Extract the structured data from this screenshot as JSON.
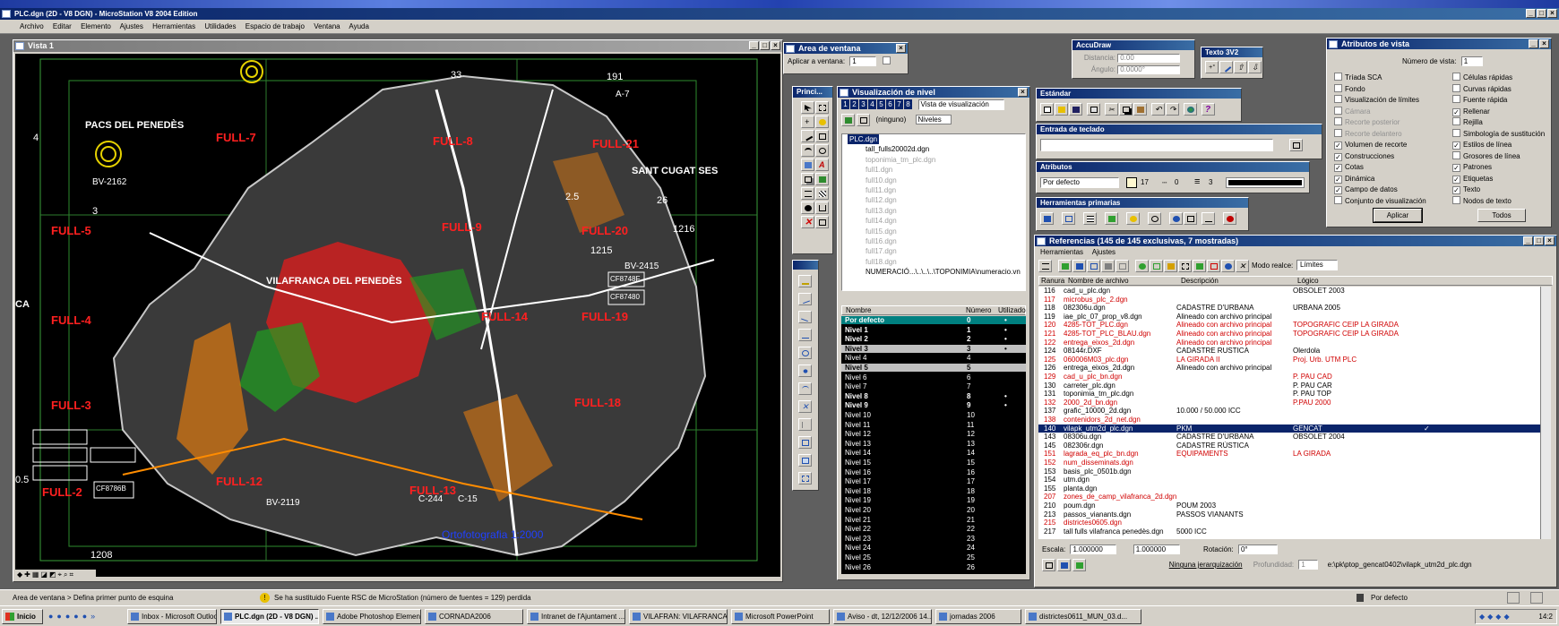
{
  "app": {
    "title": "PLC.dgn (2D - V8 DGN) - MicroStation V8 2004 Edition",
    "menu": [
      "Archivo",
      "Editar",
      "Elemento",
      "Ajustes",
      "Herramientas",
      "Utilidades",
      "Espacio de trabajo",
      "Ventana",
      "Ayuda"
    ]
  },
  "view": {
    "title": "Vista 1",
    "labels": {
      "pacs": "PACS DEL PENEDÈS",
      "santcugat": "SANT CUGAT SES",
      "vilafranca": "VILAFRANCA DEL PENEDÈS",
      "ca": "CA",
      "full21": "FULL-21",
      "full20": "FULL-20",
      "full18": "FULL-18",
      "full13": "FULL-13",
      "full5": "FULL-5",
      "full4": "FULL-4",
      "full3": "FULL-3",
      "full2": "FULL-2",
      "full19": "FULL-19",
      "full9": "FULL-9",
      "full14": "FULL-14",
      "full12": "FULL-12",
      "full7": "FULL-7",
      "full8": "FULL-8",
      "bv2162": "BV-2162",
      "bv2119": "BV-2119",
      "bv2415": "BV-2415",
      "c244": "C-244",
      "c15": "C-15",
      "n1208": "1208",
      "n1216": "1216",
      "n1215": "1215",
      "n191": "191",
      "n33": "33",
      "n26": "26",
      "n3": "3",
      "n4": "4",
      "n125": "2.5",
      "n05": "0.5",
      "a7": "A-7",
      "cf87": "CF8786B",
      "cf874": "CF8748F",
      "cf8740": "CF87480",
      "orto": "Ortofotografia 1:2000"
    }
  },
  "area_ventana": {
    "title": "Area de ventana",
    "apply_label": "Aplicar a ventana:",
    "apply_value": "1"
  },
  "principal": {
    "title": "Princi..."
  },
  "accudraw": {
    "title": "AccuDraw",
    "dist_label": "Distancia:",
    "dist_value": "0.00",
    "angle_label": "Ángulo:",
    "angle_value": "0.0000°"
  },
  "texto": {
    "title": "Texto 3V2"
  },
  "estandar": {
    "title": "Estándar"
  },
  "entrada": {
    "title": "Entrada de teclado"
  },
  "atributos": {
    "title": "Atributos",
    "level": "Por defecto",
    "color": "17",
    "style": "0",
    "weight": "3"
  },
  "herramientas": {
    "title": "Herramientas primarias"
  },
  "visualizacion": {
    "title": "Visualización de nivel",
    "numbers": [
      "1",
      "2",
      "3",
      "4",
      "5",
      "6",
      "7",
      "8"
    ],
    "mode": "Vista de visualización",
    "ninguno": "(ninguno)",
    "niveles": "Niveles",
    "tree": [
      "PLC.dgn",
      "tall_fulls20002d.dgn",
      "toponimia_tm_plc.dgn",
      "full1.dgn",
      "full10.dgn",
      "full11.dgn",
      "full12.dgn",
      "full13.dgn",
      "full14.dgn",
      "full15.dgn",
      "full16.dgn",
      "full17.dgn",
      "full18.dgn",
      "NUMERACIÓ...\\..\\..\\..\\TOPONIMIA\\numeracio.vn"
    ],
    "headers": [
      "Nombre",
      "Número",
      "Utilizado"
    ],
    "levels": [
      {
        "name": "Por defecto",
        "num": "0",
        "used": "•"
      },
      {
        "name": "Nivel 1",
        "num": "1",
        "used": "•"
      },
      {
        "name": "Nivel 2",
        "num": "2",
        "used": "•"
      },
      {
        "name": "Nivel 3",
        "num": "3",
        "used": "•"
      },
      {
        "name": "Nivel 4",
        "num": "4",
        "used": ""
      },
      {
        "name": "Nivel 5",
        "num": "5",
        "used": ""
      },
      {
        "name": "Nivel 6",
        "num": "6",
        "used": ""
      },
      {
        "name": "Nivel 7",
        "num": "7",
        "used": ""
      },
      {
        "name": "Nivel 8",
        "num": "8",
        "used": "•"
      },
      {
        "name": "Nivel 9",
        "num": "9",
        "used": "•"
      },
      {
        "name": "Nivel 10",
        "num": "10",
        "used": ""
      },
      {
        "name": "Nivel 11",
        "num": "11",
        "used": ""
      },
      {
        "name": "Nivel 12",
        "num": "12",
        "used": ""
      },
      {
        "name": "Nivel 13",
        "num": "13",
        "used": ""
      },
      {
        "name": "Nivel 14",
        "num": "14",
        "used": ""
      },
      {
        "name": "Nivel 15",
        "num": "15",
        "used": ""
      },
      {
        "name": "Nivel 16",
        "num": "16",
        "used": ""
      },
      {
        "name": "Nivel 17",
        "num": "17",
        "used": ""
      },
      {
        "name": "Nivel 18",
        "num": "18",
        "used": ""
      },
      {
        "name": "Nivel 19",
        "num": "19",
        "used": ""
      },
      {
        "name": "Nivel 20",
        "num": "20",
        "used": ""
      },
      {
        "name": "Nivel 21",
        "num": "21",
        "used": ""
      },
      {
        "name": "Nivel 22",
        "num": "22",
        "used": ""
      },
      {
        "name": "Nivel 23",
        "num": "23",
        "used": ""
      },
      {
        "name": "Nivel 24",
        "num": "24",
        "used": ""
      },
      {
        "name": "Nivel 25",
        "num": "25",
        "used": ""
      },
      {
        "name": "Nivel 26",
        "num": "26",
        "used": ""
      }
    ]
  },
  "atributos_vista": {
    "title": "Atributos de vista",
    "view_label": "Número de vista:",
    "view_value": "1",
    "left": [
      {
        "label": "Tríada SCA",
        "checked": false
      },
      {
        "label": "Fondo",
        "checked": false
      },
      {
        "label": "Visualización de límites",
        "checked": false
      },
      {
        "label": "Cámara",
        "checked": false
      },
      {
        "label": "Recorte posterior",
        "checked": false
      },
      {
        "label": "Recorte delantero",
        "checked": false
      },
      {
        "label": "Volumen de recorte",
        "checked": true
      },
      {
        "label": "Construcciones",
        "checked": true
      },
      {
        "label": "Cotas",
        "checked": true
      },
      {
        "label": "Dinámica",
        "checked": true
      },
      {
        "label": "Campo de datos",
        "checked": true
      },
      {
        "label": "Conjunto de visualización",
        "checked": false
      }
    ],
    "right": [
      {
        "label": "Células rápidas",
        "checked": false
      },
      {
        "label": "Curvas rápidas",
        "checked": false
      },
      {
        "label": "Fuente rápida",
        "checked": false
      },
      {
        "label": "Rellenar",
        "checked": true
      },
      {
        "label": "Rejilla",
        "checked": false
      },
      {
        "label": "Simbología de sustitución",
        "checked": false
      },
      {
        "label": "Estilos de línea",
        "checked": true
      },
      {
        "label": "Grosores de línea",
        "checked": false
      },
      {
        "label": "Patrones",
        "checked": true
      },
      {
        "label": "Etiquetas",
        "checked": true
      },
      {
        "label": "Texto",
        "checked": true
      },
      {
        "label": "Nodos de texto",
        "checked": false
      }
    ],
    "apply": "Aplicar",
    "all": "Todos"
  },
  "referencias": {
    "title": "Referencias (145 de 145 exclusivas, 7 mostradas)",
    "menu": [
      "Herramientas",
      "Ajustes"
    ],
    "mode_label": "Modo realce:",
    "mode_value": "Límites",
    "headers": [
      "Ranura",
      "Nombre de archivo",
      "Descripción",
      "Lógico"
    ],
    "rows": [
      {
        "slot": "116",
        "file": "cad_u_plc.dgn",
        "desc": "",
        "logic": "OBSOLET 2003",
        "red": false
      },
      {
        "slot": "117",
        "file": "microbus_plc_2.dgn",
        "desc": "",
        "logic": "",
        "red": true
      },
      {
        "slot": "118",
        "file": "082306u.dgn",
        "desc": "CADASTRE D'URBANA",
        "logic": "URBANA 2005",
        "red": false
      },
      {
        "slot": "119",
        "file": "iae_plc_07_prop_v8.dgn",
        "desc": "Alineado con archivo principal",
        "logic": "",
        "red": false
      },
      {
        "slot": "120",
        "file": "4285-TOT_PLC.dgn",
        "desc": "Alineado con archivo principal",
        "logic": "TOPOGRAFIC CEIP LA GIRADA",
        "red": true
      },
      {
        "slot": "121",
        "file": "4285-TOT_PLC_BLAU.dgn",
        "desc": "Alineado con archivo principal",
        "logic": "TOPOGRAFIC CEIP LA GIRADA",
        "red": true
      },
      {
        "slot": "122",
        "file": "entrega_eixos_2d.dgn",
        "desc": "Alineado con archivo principal",
        "logic": "",
        "red": true
      },
      {
        "slot": "124",
        "file": "08144r.DXF",
        "desc": "CADASTRE RUSTICA",
        "logic": "Olerdola",
        "red": false
      },
      {
        "slot": "125",
        "file": "060006M03_plc.dgn",
        "desc": "LA GIRADA II",
        "logic": "Proj. Urb. UTM PLC",
        "red": true
      },
      {
        "slot": "126",
        "file": "entrega_eixos_2d.dgn",
        "desc": "Alineado con archivo principal",
        "logic": "",
        "red": false
      },
      {
        "slot": "129",
        "file": "cad_u_plc_bn.dgn",
        "desc": "",
        "logic": "P. PAU CAD",
        "red": true
      },
      {
        "slot": "130",
        "file": "carreter_plc.dgn",
        "desc": "",
        "logic": "P. PAU CAR",
        "red": false
      },
      {
        "slot": "131",
        "file": "toponimia_tm_plc.dgn",
        "desc": "",
        "logic": "P. PAU TOP",
        "red": false
      },
      {
        "slot": "132",
        "file": "2000_2d_bn.dgn",
        "desc": "",
        "logic": "P.PAU 2000",
        "red": true
      },
      {
        "slot": "137",
        "file": "grafic_10000_2d.dgn",
        "desc": "10.000 / 50.000 ICC",
        "logic": "",
        "red": false
      },
      {
        "slot": "138",
        "file": "contenidors_2d_net.dgn",
        "desc": "",
        "logic": "",
        "red": true
      },
      {
        "slot": "140",
        "file": "vilapk_utm2d_plc.dgn",
        "desc": "PKM",
        "logic": "GENCAT",
        "red": false,
        "selected": true
      },
      {
        "slot": "143",
        "file": "08306u.dgn",
        "desc": "CADASTRE D'URBANA",
        "logic": "OBSOLET 2004",
        "red": false
      },
      {
        "slot": "145",
        "file": "082306r.dgn",
        "desc": "CADASTRE RÚSTICA",
        "logic": "",
        "red": false
      },
      {
        "slot": "151",
        "file": "lagrada_eq_plc_bn.dgn",
        "desc": "EQUIPAMENTS",
        "logic": "LA GIRADA",
        "red": true
      },
      {
        "slot": "152",
        "file": "num_disseminats.dgn",
        "desc": "",
        "logic": "",
        "red": true
      },
      {
        "slot": "153",
        "file": "basis_plc_0501b.dgn",
        "desc": "",
        "logic": "",
        "red": false
      },
      {
        "slot": "154",
        "file": "utm.dgn",
        "desc": "",
        "logic": "",
        "red": false
      },
      {
        "slot": "155",
        "file": "planta.dgn",
        "desc": "",
        "logic": "",
        "red": false
      },
      {
        "slot": "207",
        "file": "zones_de_camp_vilafranca_2d.dgn",
        "desc": "",
        "logic": "",
        "red": true
      },
      {
        "slot": "210",
        "file": "poum.dgn",
        "desc": "POUM 2003",
        "logic": "",
        "red": false
      },
      {
        "slot": "213",
        "file": "passos_vianants.dgn",
        "desc": "PASSOS VIANANTS",
        "logic": "",
        "red": false
      },
      {
        "slot": "215",
        "file": "districtes0605.dgn",
        "desc": "",
        "logic": "",
        "red": true
      },
      {
        "slot": "217",
        "file": "tall fulls vilafranca penedès.dgn",
        "desc": "5000 ICC",
        "logic": "",
        "red": false
      }
    ],
    "escala_label": "Escala:",
    "escala_a": "1.000000",
    "escala_b": "1.000000",
    "rot_label": "Rotación:",
    "rot_value": "0°",
    "jerarquia": "Ninguna jerarquización",
    "prof_label": "Profundidad:",
    "prof_value": "1",
    "path": "e:\\pk\\ptop_gencat0402\\vilapk_utm2d_plc.dgn"
  },
  "status": {
    "left": "Area de ventana > Defina primer punto de esquina",
    "mid": "Se ha sustituido Fuente RSC de MicroStation (número de fuentes = 129) perdida",
    "right": "Por defecto"
  },
  "taskbar": {
    "start": "Inicio",
    "items": [
      "Inbox - Microsoft Outlook",
      "PLC.dgn (2D - V8 DGN) ...",
      "Adobe Photoshop Elements",
      "CORNADA2006",
      "Intranet de l'Ajuntament ...",
      "VILAFRAN: VILAFRANCA...",
      "Microsoft PowerPoint",
      "Aviso - dt, 12/12/2006 14...",
      "jornadas 2006",
      "districtes0611_MUN_03.d..."
    ],
    "time": "14:2"
  }
}
